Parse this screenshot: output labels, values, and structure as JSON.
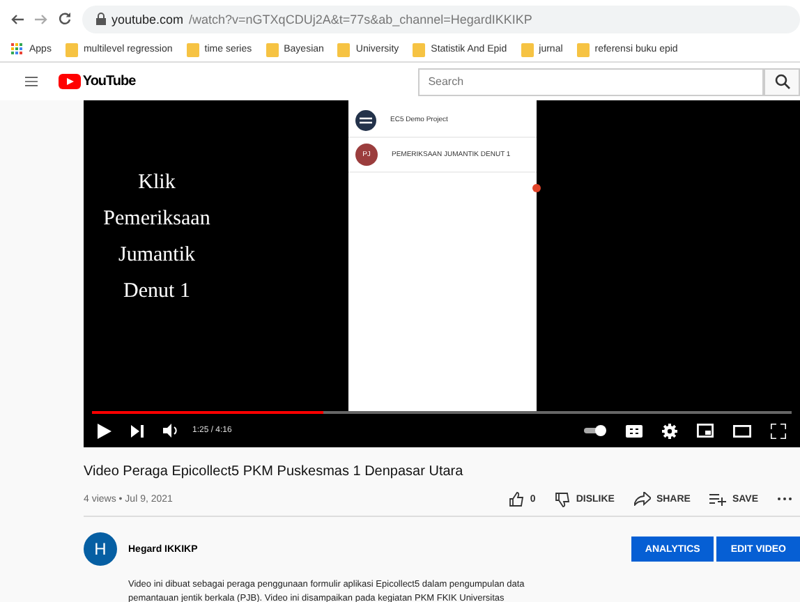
{
  "browser": {
    "url_host": "youtube.com",
    "url_path": "/watch?v=nGTXqCDUj2A&t=77s&ab_channel=HegardIKKIKP",
    "bookmarks": [
      {
        "kind": "apps",
        "label": "Apps"
      },
      {
        "kind": "folder",
        "label": "multilevel regression"
      },
      {
        "kind": "folder",
        "label": "time series"
      },
      {
        "kind": "folder",
        "label": "Bayesian"
      },
      {
        "kind": "folder",
        "label": "University"
      },
      {
        "kind": "folder",
        "label": "Statistik And Epid"
      },
      {
        "kind": "folder",
        "label": "jurnal"
      },
      {
        "kind": "folder",
        "label": "referensi buku epid"
      }
    ]
  },
  "header": {
    "logo": "YouTube",
    "search": {
      "placeholder": "Search"
    }
  },
  "video": {
    "slide_lines": [
      "Klik",
      "Pemeriksaan",
      "Jumantik",
      "Denut 1"
    ],
    "phone_items": [
      {
        "kind": "logo",
        "label": "EC5 Demo Project"
      },
      {
        "kind": "initials",
        "initials": "PJ",
        "label": "PEMERIKSAAN JUMANTIK DENUT 1"
      }
    ],
    "progress": {
      "level": 0.33
    },
    "time": "1:25 / 4:16"
  },
  "title": "Video Peraga Epicollect5 PKM Puskesmas 1 Denpasar Utara",
  "meta": "4 views • Jul 9, 2021",
  "actions": [
    {
      "kind": "like",
      "label": "0"
    },
    {
      "kind": "dislike",
      "label": "DISLIKE"
    },
    {
      "kind": "share",
      "label": "SHARE"
    },
    {
      "kind": "save",
      "label": "SAVE"
    }
  ],
  "channel": {
    "initial": "H",
    "name": "Hegard IKKIKP",
    "buttons": [
      "ANALYTICS",
      "EDIT VIDEO"
    ]
  },
  "description": [
    "Video ini dibuat sebagai peraga penggunaan formulir aplikasi Epicollect5 dalam pengumpulan data",
    "pemantauan jentik berkala (PJB). Video ini disampaikan pada kegiatan PKM FKIK Universitas"
  ]
}
